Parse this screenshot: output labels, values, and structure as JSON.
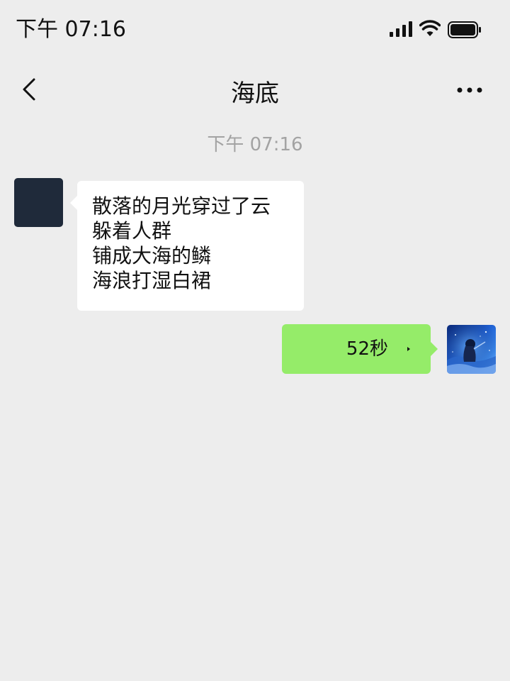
{
  "status_bar": {
    "time": "下午 07:16"
  },
  "header": {
    "title": "海底",
    "back_icon": "chevron-left-icon",
    "more_icon": "more-dots-icon"
  },
  "chat": {
    "timestamp": "下午 07:16",
    "messages": [
      {
        "direction": "incoming",
        "lines": [
          "散落的月光穿过了云",
          "躲着人群",
          "铺成大海的鳞",
          "海浪打湿白裙"
        ]
      },
      {
        "direction": "outgoing",
        "type": "voice",
        "duration": "52秒"
      }
    ]
  },
  "colors": {
    "background": "#ededed",
    "incoming_bubble": "#ffffff",
    "outgoing_bubble": "#95ec69",
    "timestamp_text": "#a3a3a3"
  }
}
